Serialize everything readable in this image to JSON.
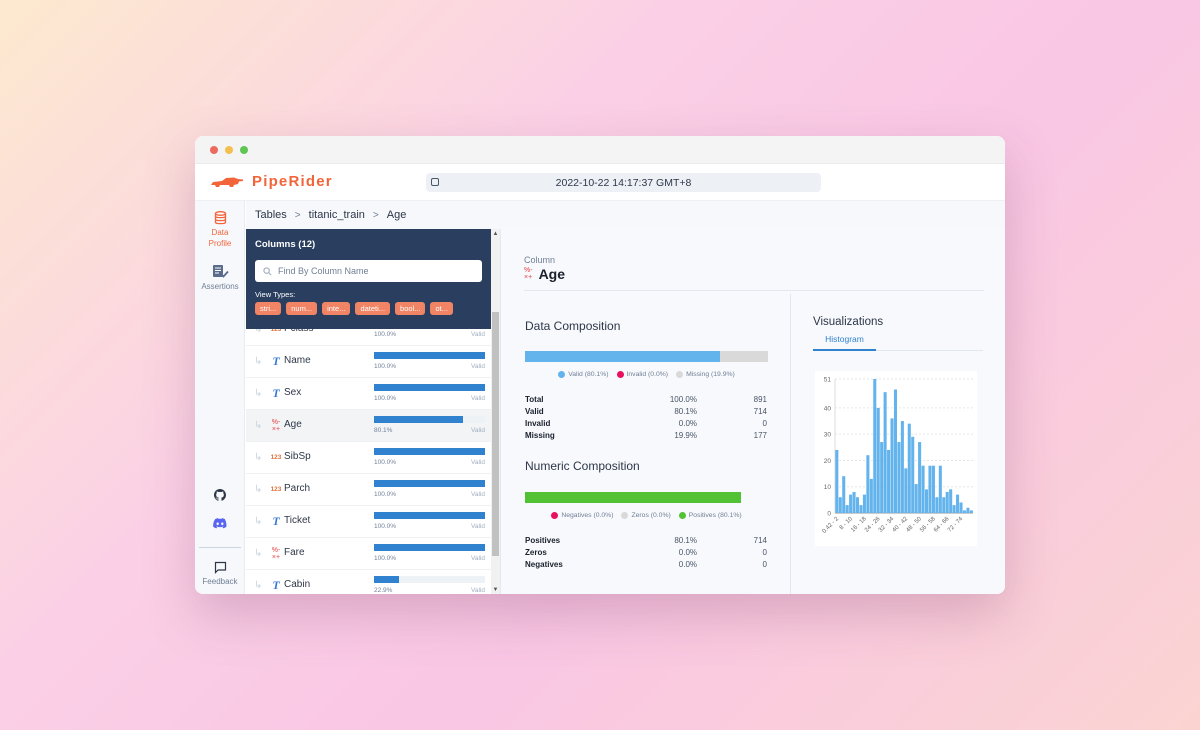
{
  "app": {
    "brand": "PipeRider",
    "brand_color": "#f2653a",
    "timestamp": "2022-10-22 14:17:37 GMT+8"
  },
  "nav": {
    "items": [
      {
        "label": "Data Profile",
        "icon": "database-icon",
        "active": true
      },
      {
        "label": "Assertions",
        "icon": "assertions-icon",
        "active": false
      }
    ],
    "bottom": [
      {
        "icon": "github-icon"
      },
      {
        "icon": "discord-icon"
      },
      {
        "label": "Feedback",
        "icon": "feedback-icon"
      }
    ]
  },
  "breadcrumb": [
    "Tables",
    "titanic_train",
    "Age"
  ],
  "columns_panel": {
    "title": "Columns (12)",
    "search_placeholder": "Find By Column Name",
    "view_types_label": "View Types:",
    "view_types": [
      "stri...",
      "num...",
      "inte...",
      "dateti...",
      "bool...",
      "ot..."
    ],
    "rows": [
      {
        "name": "Pclass",
        "type": "integer",
        "type_icon": "123",
        "valid_pct": 100.0,
        "valid_label": "100.0%",
        "status": "Valid"
      },
      {
        "name": "Name",
        "type": "string",
        "type_icon": "T",
        "valid_pct": 100.0,
        "valid_label": "100.0%",
        "status": "Valid"
      },
      {
        "name": "Sex",
        "type": "string",
        "type_icon": "T",
        "valid_pct": 100.0,
        "valid_label": "100.0%",
        "status": "Valid"
      },
      {
        "name": "Age",
        "type": "numeric",
        "type_icon": "decimal",
        "valid_pct": 80.1,
        "valid_label": "80.1%",
        "status": "Valid",
        "selected": true
      },
      {
        "name": "SibSp",
        "type": "integer",
        "type_icon": "123",
        "valid_pct": 100.0,
        "valid_label": "100.0%",
        "status": "Valid"
      },
      {
        "name": "Parch",
        "type": "integer",
        "type_icon": "123",
        "valid_pct": 100.0,
        "valid_label": "100.0%",
        "status": "Valid"
      },
      {
        "name": "Ticket",
        "type": "string",
        "type_icon": "T",
        "valid_pct": 100.0,
        "valid_label": "100.0%",
        "status": "Valid"
      },
      {
        "name": "Fare",
        "type": "numeric",
        "type_icon": "decimal",
        "valid_pct": 100.0,
        "valid_label": "100.0%",
        "status": "Valid"
      },
      {
        "name": "Cabin",
        "type": "string",
        "type_icon": "T",
        "valid_pct": 22.9,
        "valid_label": "22.9%",
        "status": "Valid"
      }
    ]
  },
  "column_detail": {
    "label": "Column",
    "name": "Age",
    "data_composition": {
      "title": "Data Composition",
      "segments": [
        {
          "name": "Valid",
          "pct": 80.1,
          "color": "#63b3ed"
        },
        {
          "name": "Invalid",
          "pct": 0.0,
          "color": "#e8115b"
        },
        {
          "name": "Missing",
          "pct": 19.9,
          "color": "#d9d9d9"
        }
      ],
      "legend": [
        "Valid  (80.1%)",
        "Invalid  (0.0%)",
        "Missing  (19.9%)"
      ],
      "stats": [
        {
          "key": "Total",
          "pct": "100.0%",
          "count": "891"
        },
        {
          "key": "Valid",
          "pct": "80.1%",
          "count": "714"
        },
        {
          "key": "Invalid",
          "pct": "0.0%",
          "count": "0"
        },
        {
          "key": "Missing",
          "pct": "19.9%",
          "count": "177"
        }
      ]
    },
    "numeric_composition": {
      "title": "Numeric Composition",
      "segments": [
        {
          "name": "Negatives",
          "pct": 0.0,
          "color": "#e8115b"
        },
        {
          "name": "Zeros",
          "pct": 0.0,
          "color": "#d9d9d9"
        },
        {
          "name": "Positives",
          "pct": 80.1,
          "color": "#52c234"
        }
      ],
      "legend": [
        "Negatives  (0.0%)",
        "Zeros  (0.0%)",
        "Positives  (80.1%)"
      ],
      "stats": [
        {
          "key": "Positives",
          "pct": "80.1%",
          "count": "714"
        },
        {
          "key": "Zeros",
          "pct": "0.0%",
          "count": "0"
        },
        {
          "key": "Negatives",
          "pct": "0.0%",
          "count": "0"
        }
      ]
    }
  },
  "visualizations": {
    "title": "Visualizations",
    "tabs": [
      "Histogram"
    ],
    "active_tab": "Histogram"
  },
  "chart_data": {
    "type": "bar",
    "title": "",
    "xlabel": "",
    "ylabel": "",
    "ylim": [
      0,
      51
    ],
    "yticks": [
      0,
      10,
      20,
      30,
      40,
      51
    ],
    "xtick_labels": [
      "0.42 - 2",
      "8 - 10",
      "16 - 18",
      "24 - 26",
      "32 - 34",
      "40 - 42",
      "48 - 50",
      "56 - 58",
      "64 - 66",
      "72 - 74"
    ],
    "xtick_every": 4,
    "grid": true,
    "color": "#63b3ed",
    "categories": [
      "0.42 - 2",
      "2 - 4",
      "4 - 6",
      "6 - 8",
      "8 - 10",
      "10 - 12",
      "12 - 14",
      "14 - 16",
      "16 - 18",
      "18 - 20",
      "20 - 22",
      "22 - 24",
      "24 - 26",
      "26 - 28",
      "28 - 30",
      "30 - 32",
      "32 - 34",
      "34 - 36",
      "36 - 38",
      "38 - 40",
      "40 - 42",
      "42 - 44",
      "44 - 46",
      "46 - 48",
      "48 - 50",
      "50 - 52",
      "52 - 54",
      "54 - 56",
      "56 - 58",
      "58 - 60",
      "60 - 62",
      "62 - 64",
      "64 - 66",
      "66 - 68",
      "68 - 70",
      "70 - 72",
      "72 - 74",
      "74 - 76",
      "76 - 78",
      "78 - 80"
    ],
    "values": [
      24,
      6,
      14,
      3,
      7,
      8,
      6,
      3,
      7,
      22,
      13,
      51,
      40,
      27,
      46,
      24,
      36,
      47,
      27,
      35,
      17,
      34,
      29,
      11,
      27,
      18,
      9,
      18,
      18,
      6,
      18,
      6,
      8,
      9,
      3,
      7,
      4,
      1,
      2,
      1
    ]
  }
}
